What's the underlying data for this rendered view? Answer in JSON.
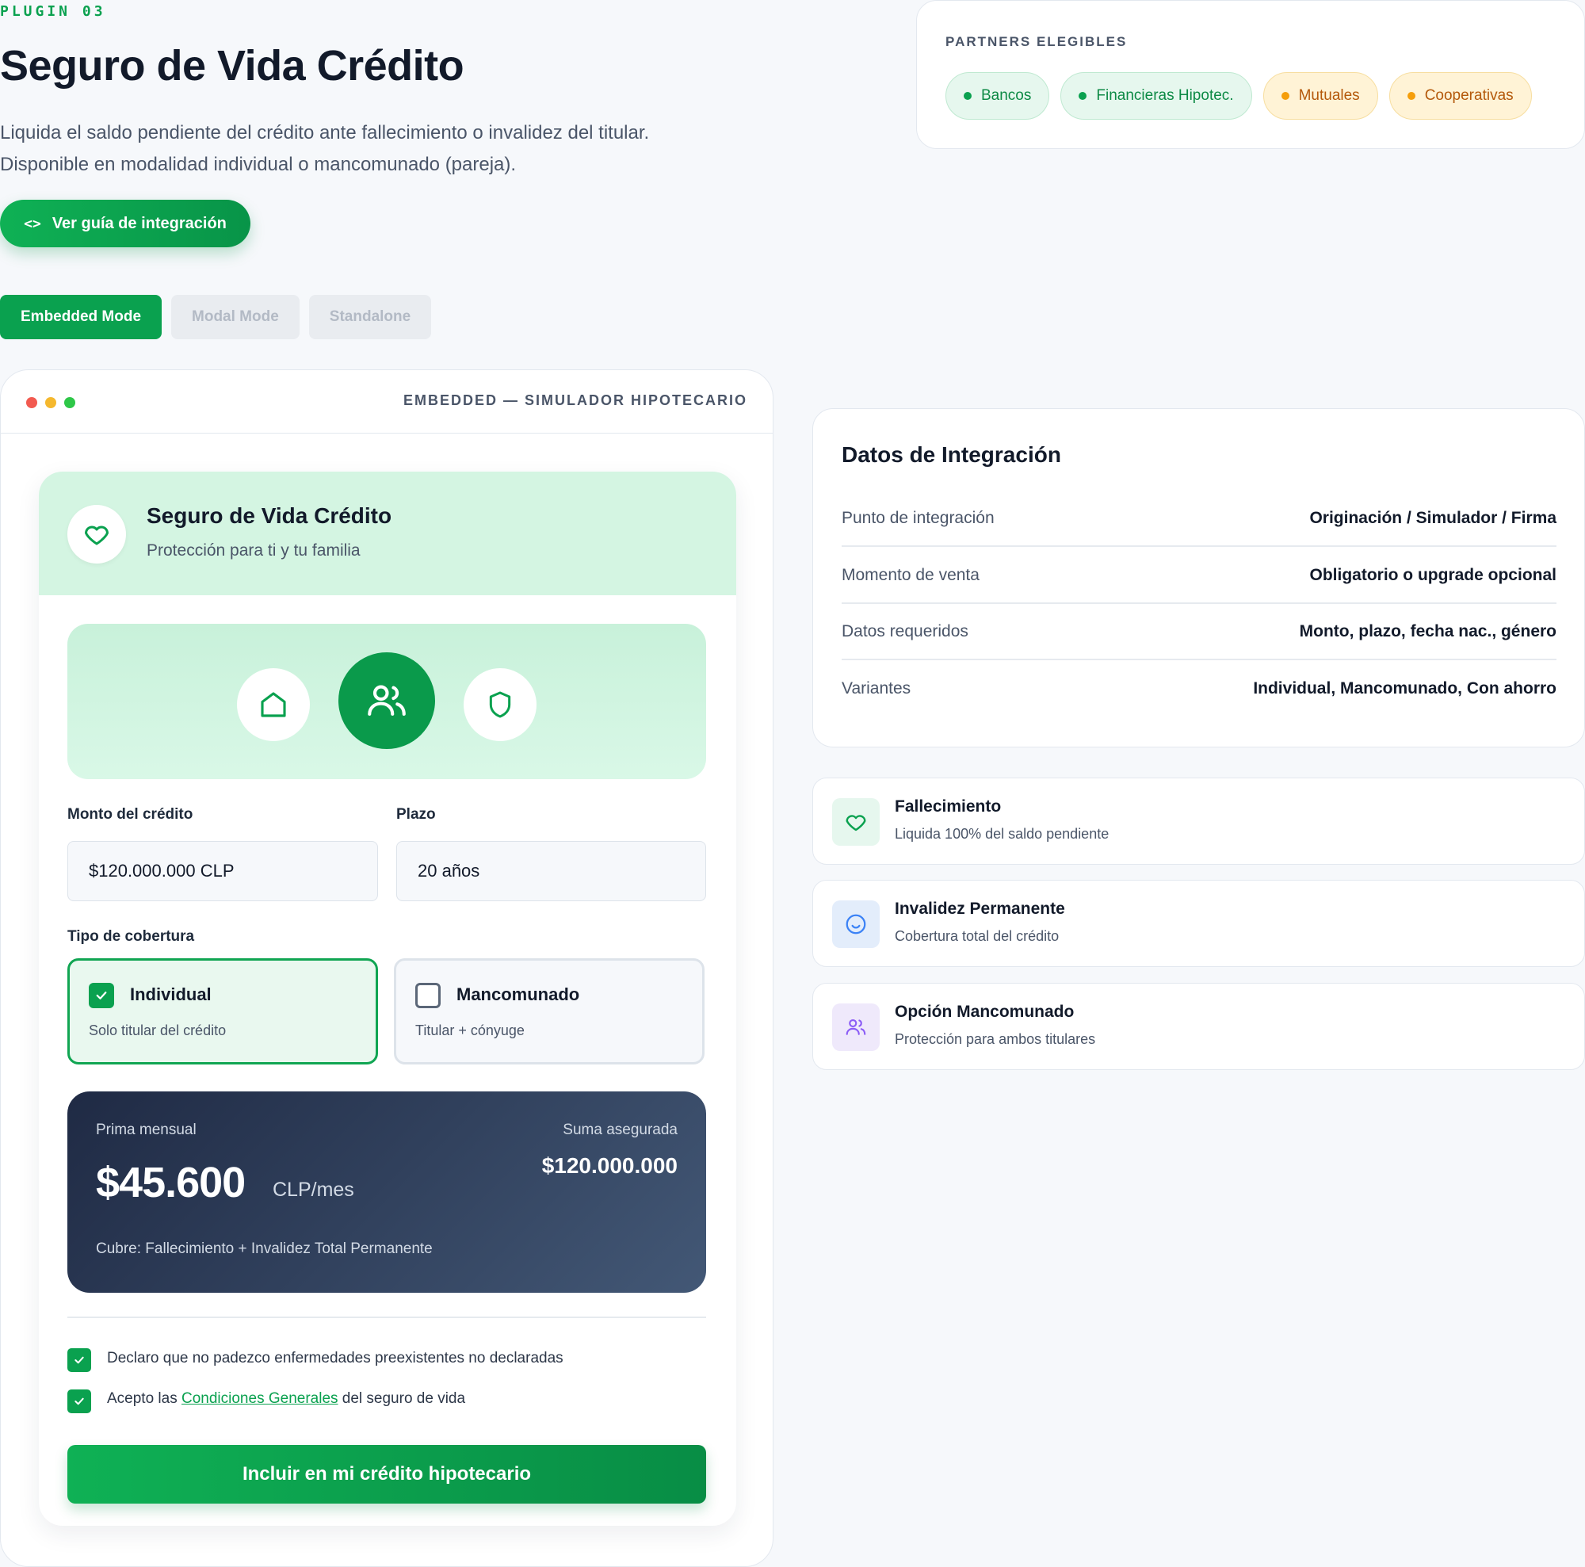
{
  "header": {
    "plugin_tag": "PLUGIN 03",
    "title": "Seguro de Vida Crédito",
    "description_line1": "Liquida el saldo pendiente del crédito ante fallecimiento o invalidez del titular.",
    "description_line2": "Disponible en modalidad individual o mancomunado (pareja).",
    "guide_button": "Ver guía de integración"
  },
  "partners": {
    "label": "PARTNERS ELEGIBLES",
    "chips": [
      {
        "label": "Bancos",
        "tone": "green"
      },
      {
        "label": "Financieras Hipotec.",
        "tone": "green"
      },
      {
        "label": "Mutuales",
        "tone": "amber"
      },
      {
        "label": "Cooperativas",
        "tone": "amber"
      }
    ]
  },
  "mode_tabs": [
    {
      "label": "Embedded Mode",
      "active": true
    },
    {
      "label": "Modal Mode",
      "active": false
    },
    {
      "label": "Standalone",
      "active": false
    }
  ],
  "window": {
    "title": "EMBEDDED — SIMULADOR HIPOTECARIO",
    "dot_colors": [
      "#f25a50",
      "#f5b82e",
      "#2ec748"
    ]
  },
  "widget": {
    "title": "Seguro de Vida Crédito",
    "subtitle": "Protección para ti y tu familia",
    "hero_icons": [
      "home-icon",
      "users-icon",
      "shield-icon"
    ],
    "amount_label": "Monto del crédito",
    "amount_value": "$120.000.000 CLP",
    "term_label": "Plazo",
    "term_value": "20 años",
    "coverage_label": "Tipo de cobertura",
    "options": [
      {
        "title": "Individual",
        "subtitle": "Solo titular del crédito",
        "selected": true
      },
      {
        "title": "Mancomunado",
        "subtitle": "Titular + cónyuge",
        "selected": false
      }
    ],
    "price": {
      "premium_label": "Prima mensual",
      "premium_value": "$45.600",
      "premium_unit": "CLP/mes",
      "insured_label": "Suma asegurada",
      "insured_value": "$120.000.000",
      "covers": "Cubre: Fallecimiento + Invalidez Total Permanente"
    },
    "declaration": "Declaro que no padezco enfermedades preexistentes no declaradas",
    "accept_prefix": "Acepto las ",
    "accept_link": "Condiciones Generales",
    "accept_suffix": " del seguro de vida",
    "cta": "Incluir en mi crédito hipotecario"
  },
  "integration": {
    "title": "Datos de Integración",
    "rows": [
      {
        "key": "Punto de integración",
        "value": "Originación / Simulador / Firma"
      },
      {
        "key": "Momento de venta",
        "value": "Obligatorio o upgrade opcional"
      },
      {
        "key": "Datos requeridos",
        "value": "Monto, plazo, fecha nac., género"
      },
      {
        "key": "Variantes",
        "value": "Individual, Mancomunado, Con ahorro"
      }
    ]
  },
  "features": [
    {
      "title": "Fallecimiento",
      "subtitle": "Liquida 100% del saldo pendiente",
      "icon": "heart-icon",
      "bg": "#e6f7ee"
    },
    {
      "title": "Invalidez Permanente",
      "subtitle": "Cobertura total del crédito",
      "icon": "smile-icon",
      "bg": "#e3edfb"
    },
    {
      "title": "Opción Mancomunado",
      "subtitle": "Protección para ambos titulares",
      "icon": "users-icon",
      "bg": "#efe9fb"
    }
  ],
  "colors": {
    "accent": "#0aa14f",
    "dark_card": "#1f2a44"
  }
}
